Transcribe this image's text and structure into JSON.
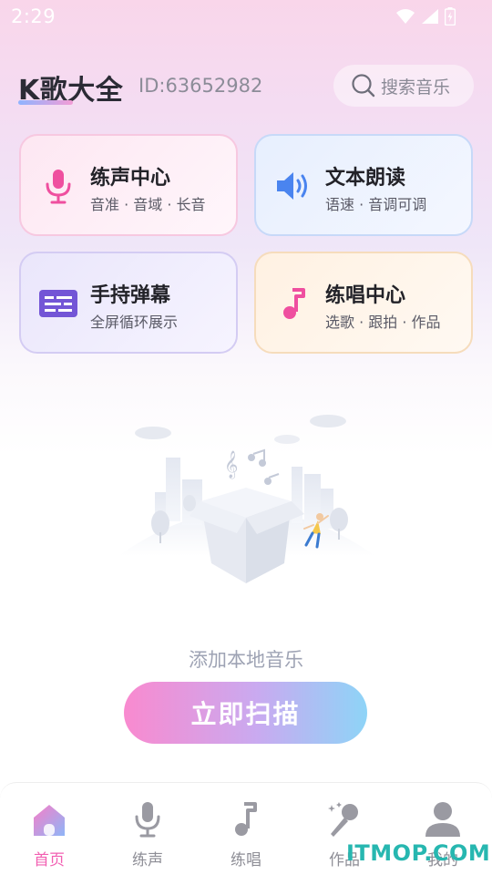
{
  "status_bar": {
    "time": "2:29",
    "icons": [
      "wifi-icon",
      "signal-icon",
      "battery-charging-icon"
    ]
  },
  "header": {
    "app_title": "K歌大全",
    "user_id": "ID:63652982",
    "search_placeholder": "搜索音乐",
    "search_icon": "search-icon"
  },
  "feature_cards": [
    {
      "title": "练声中心",
      "subtitle": "音准 · 音域 · 长音",
      "icon": "microphone-icon",
      "color": "#ef4f9f"
    },
    {
      "title": "文本朗读",
      "subtitle": "语速 · 音调可调",
      "icon": "speaker-icon",
      "color": "#4a84ef"
    },
    {
      "title": "手持弹幕",
      "subtitle": "全屏循环展示",
      "icon": "subtitles-icon",
      "color": "#7355d6"
    },
    {
      "title": "练唱中心",
      "subtitle": "选歌 · 跟拍 · 作品",
      "icon": "music-note-icon",
      "color": "#ef4f9f"
    }
  ],
  "empty_state": {
    "text": "添加本地音乐",
    "button_label": "立即扫描"
  },
  "bottom_nav": {
    "items": [
      {
        "label": "首页",
        "icon": "home-icon",
        "active": true
      },
      {
        "label": "练声",
        "icon": "microphone-icon",
        "active": false
      },
      {
        "label": "练唱",
        "icon": "music-note-icon",
        "active": false
      },
      {
        "label": "作品",
        "icon": "magic-mic-icon",
        "active": false
      },
      {
        "label": "我的",
        "icon": "user-icon",
        "active": false
      }
    ]
  },
  "watermark": "ITMOP.COM",
  "colors": {
    "accent_pink": "#f25fb2",
    "accent_blue": "#4a84ef",
    "accent_purple": "#7355d6",
    "button_gradient": [
      "#f98acf",
      "#c9aaf0",
      "#8ed4f7"
    ]
  }
}
